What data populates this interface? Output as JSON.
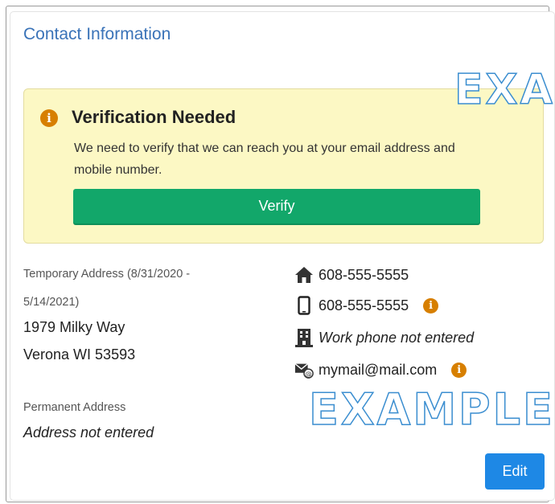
{
  "section": {
    "title": "Contact Information"
  },
  "alert": {
    "title": "Verification Needed",
    "body": "We need to verify that we can reach you at your email address and mobile number.",
    "button_label": "Verify"
  },
  "addresses": {
    "temporary_label_line1": "Temporary Address (8/31/2020 -",
    "temporary_label_line2": "5/14/2021)",
    "temporary_line1": "1979 Milky Way",
    "temporary_line2": "Verona WI 53593",
    "permanent_label": "Permanent Address",
    "permanent_value": "Address not entered"
  },
  "contacts": {
    "home_phone": "608-555-5555",
    "mobile_phone": "608-555-5555",
    "work_phone": "Work phone not entered",
    "email": "mymail@mail.com",
    "icons": [
      "home-icon",
      "mobile-phone-icon",
      "building-icon",
      "email-icon",
      "info-icon"
    ]
  },
  "watermark": {
    "text_top": "EXA",
    "text_bottom": "EXAMPLE"
  },
  "actions": {
    "edit_label": "Edit"
  },
  "colors": {
    "accent_blue": "#1e88e5",
    "title_blue": "#3a73b8",
    "alert_bg": "#fcf8c4",
    "verify_green": "#12a76a",
    "info_orange": "#d77f00"
  }
}
